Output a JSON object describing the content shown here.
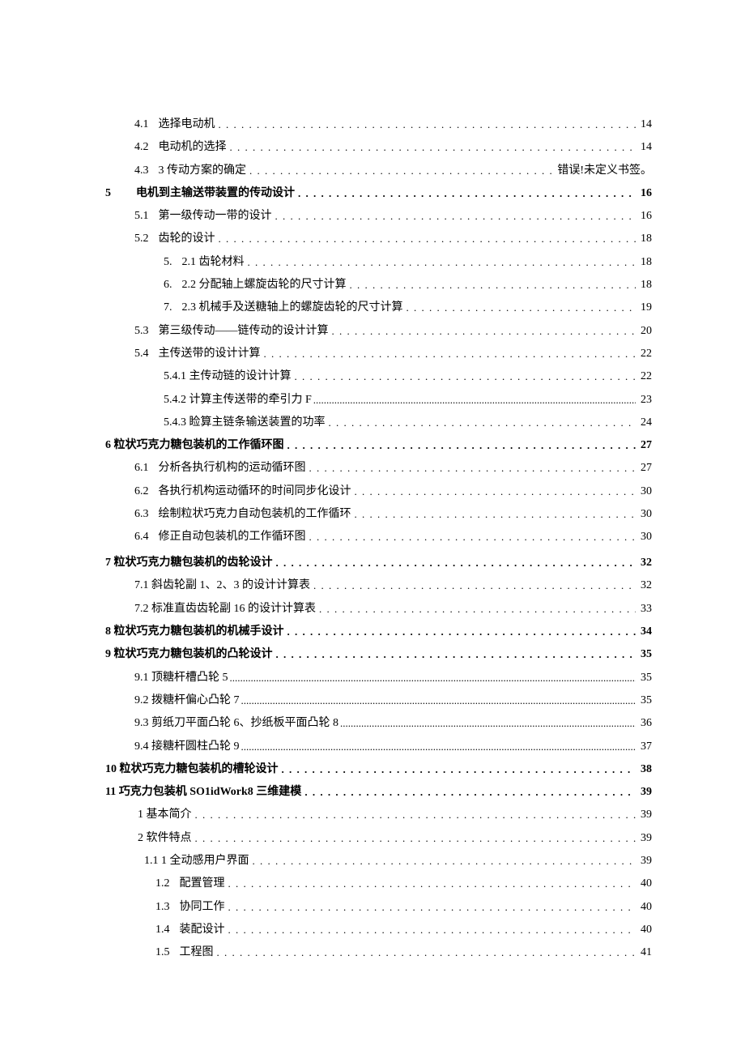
{
  "toc": [
    {
      "cls": "lvl1",
      "num": "4.1",
      "title": "选择电动机",
      "page": "14",
      "dot": "dots"
    },
    {
      "cls": "lvl1",
      "num": "4.2",
      "title": "电动机的选择",
      "page": "14",
      "dot": "dots"
    },
    {
      "cls": "lvl1",
      "num": "4.3",
      "title": "3 传动方案的确定",
      "page": "错误!未定义书签。",
      "dot": "dots"
    },
    {
      "cls": "lvl0",
      "num": "5",
      "title": "电机到主输送带装置的传动设计",
      "page": "16",
      "dot": "dots",
      "numPad": true
    },
    {
      "cls": "lvl1",
      "num": "5.1",
      "title": "第一级传动一带的设计",
      "page": "16",
      "dot": "dots"
    },
    {
      "cls": "lvl1",
      "num": "5.2",
      "title": "齿轮的设计",
      "page": "18",
      "dot": "dots"
    },
    {
      "cls": "lvl2",
      "num": "5.",
      "title": "2.1 齿轮材料",
      "page": "18",
      "dot": "dots"
    },
    {
      "cls": "lvl2",
      "num": "6.",
      "title": "2.2 分配轴上螺旋齿轮的尺寸计算",
      "page": "18",
      "dot": "dots"
    },
    {
      "cls": "lvl2",
      "num": "7.",
      "title": "2.3 机械手及送糖轴上的螺旋齿轮的尺寸计算",
      "page": "19",
      "dot": "dots"
    },
    {
      "cls": "lvl1",
      "num": "5.3",
      "title": "第三级传动——链传动的设计计算",
      "page": "20",
      "dot": "dots"
    },
    {
      "cls": "lvl1",
      "num": "5.4",
      "title": "主传送带的设计计算",
      "page": "22",
      "dot": "dots"
    },
    {
      "cls": "lvl3",
      "num": "",
      "title": "5.4.1 主传动链的设计计算",
      "page": "22",
      "dot": "dots"
    },
    {
      "cls": "lvl3",
      "num": "",
      "title": "5.4.2 计算主传送带的牵引力 F",
      "page": "23",
      "dot": "dotsTight"
    },
    {
      "cls": "lvl3",
      "num": "",
      "title": "5.4.3 睑算主链条输送装置的功率",
      "page": "24",
      "dot": "dots"
    },
    {
      "cls": "lvl0alt",
      "num": "",
      "title": "6 粒状巧克力糖包装机的工作循环图",
      "page": "27",
      "dot": "dots"
    },
    {
      "cls": "lvl1",
      "num": "6.1",
      "title": "分析各执行机构的运动循环图",
      "page": "27",
      "dot": "dots"
    },
    {
      "cls": "lvl1",
      "num": "6.2",
      "title": "各执行机构运动循环的时间同步化设计",
      "page": "30",
      "dot": "dots"
    },
    {
      "cls": "lvl1",
      "num": "6.3",
      "title": "绘制粒状巧克力自动包装机的工作循环",
      "page": "30",
      "dot": "dots"
    },
    {
      "cls": "lvl1",
      "num": "6.4",
      "title": "修正自动包装机的工作循环图",
      "page": "30",
      "dot": "dots"
    },
    {
      "cls": "lvl0alt",
      "num": "",
      "title": "7 粒状巧克力糖包装机的齿轮设计",
      "page": "32",
      "dot": "dots",
      "gap": true
    },
    {
      "cls": "lvl1b",
      "num": "",
      "title": "7.1 斜齿轮副 1、2、3 的设计计算表",
      "page": "32",
      "dot": "dots"
    },
    {
      "cls": "lvl1b",
      "num": "",
      "title": "7.2 标准直齿齿轮副 16 的设计计算表",
      "page": "33",
      "dot": "dots"
    },
    {
      "cls": "lvl0alt",
      "num": "",
      "title": "8 粒状巧克力糖包装机的机械手设计",
      "page": "34",
      "dot": "dots"
    },
    {
      "cls": "lvl0alt",
      "num": "",
      "title": "9 粒状巧克力糖包装机的凸轮设计",
      "page": "35",
      "dot": "dots"
    },
    {
      "cls": "lvl1b",
      "num": "",
      "title": "9.1 顶糖杆槽凸轮 5",
      "page": "35",
      "dot": "dotsTight"
    },
    {
      "cls": "lvl1b",
      "num": "",
      "title": "9.2 拨糖杆偏心凸轮 7",
      "page": "35",
      "dot": "dotsTight"
    },
    {
      "cls": "lvl1b",
      "num": "",
      "title": "9.3 剪纸刀平面凸轮 6、抄纸板平面凸轮 8",
      "page": "36",
      "dot": "dotsTight"
    },
    {
      "cls": "lvl1b",
      "num": "",
      "title": "9.4 接糖杆圆柱凸轮 9",
      "page": "37",
      "dot": "dotsTight"
    },
    {
      "cls": "lvl0alt",
      "num": "",
      "title": "10 粒状巧克力糖包装机的槽轮设计",
      "page": "38",
      "dot": "dots"
    },
    {
      "cls": "lvl0alt",
      "num": "",
      "title": "11 巧克力包装机 SO1idWork8 三维建模",
      "page": "39",
      "dot": "dots"
    },
    {
      "cls": "lvl1c",
      "num": "",
      "title": "1 基本简介",
      "page": "39",
      "dot": "dots"
    },
    {
      "cls": "lvl1c",
      "num": "",
      "title": "2 软件特点",
      "page": "39",
      "dot": "dots"
    },
    {
      "cls": "lvl2b",
      "num": "",
      "title": "1.1  1 全动感用户界面",
      "page": "39",
      "dot": "dots"
    },
    {
      "cls": "lvl2c",
      "num": "1.2",
      "title": "配置管理",
      "page": "40",
      "dot": "dots"
    },
    {
      "cls": "lvl2c",
      "num": "1.3",
      "title": "协同工作",
      "page": "40",
      "dot": "dots"
    },
    {
      "cls": "lvl2c",
      "num": "1.4",
      "title": "装配设计",
      "page": "40",
      "dot": "dots"
    },
    {
      "cls": "lvl2c",
      "num": "1.5",
      "title": "工程图",
      "page": "41",
      "dot": "dots"
    }
  ]
}
